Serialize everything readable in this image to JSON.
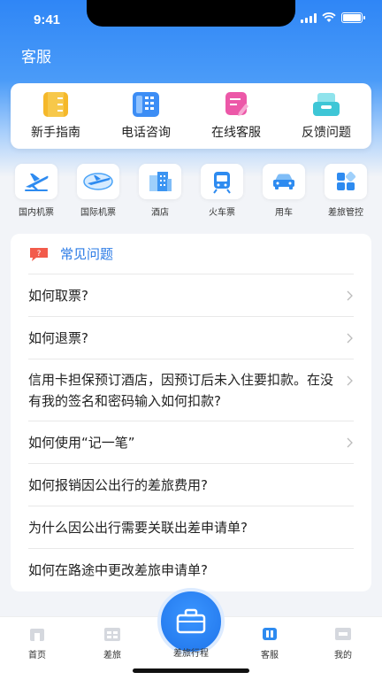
{
  "status_bar": {
    "time": "9:41"
  },
  "header": {
    "title": "客服"
  },
  "quick_actions": [
    {
      "label": "新手指南",
      "icon": "guide-icon",
      "color": "#f5b82a"
    },
    {
      "label": "电话咨询",
      "icon": "phone-icon",
      "color": "#3c8df5"
    },
    {
      "label": "在线客服",
      "icon": "chat-icon",
      "color": "#ec58a8"
    },
    {
      "label": "反馈问题",
      "icon": "feedback-icon",
      "color": "#3ec6d6"
    }
  ],
  "services": [
    {
      "label": "国内机票",
      "icon": "plane-icon"
    },
    {
      "label": "国际机票",
      "icon": "globe-plane-icon"
    },
    {
      "label": "酒店",
      "icon": "hotel-icon"
    },
    {
      "label": "火车票",
      "icon": "train-icon"
    },
    {
      "label": "用车",
      "icon": "car-icon"
    },
    {
      "label": "差旅管控",
      "icon": "grid-icon"
    }
  ],
  "faq": {
    "title": "常见问题",
    "items": [
      {
        "text": "如何取票?",
        "chevron": true
      },
      {
        "text": "如何退票?",
        "chevron": true
      },
      {
        "text": "信用卡担保预订酒店，因预订后未入住要扣款。在没有我的签名和密码输入如何扣款?",
        "chevron": true
      },
      {
        "text": "如何使用“记一笔”",
        "chevron": true
      },
      {
        "text": "如何报销因公出行的差旅费用?",
        "chevron": false
      },
      {
        "text": "为什么因公出行需要关联出差申请单?",
        "chevron": false
      },
      {
        "text": "如何在路途中更改差旅申请单?",
        "chevron": false
      }
    ]
  },
  "tab_bar": {
    "home": "首页",
    "travel": "差旅",
    "center": "差旅行程",
    "service": "客服",
    "mine": "我的",
    "active": "客服"
  },
  "colors": {
    "primary": "#2f86f6",
    "accent_blue": "#2b7be6"
  }
}
